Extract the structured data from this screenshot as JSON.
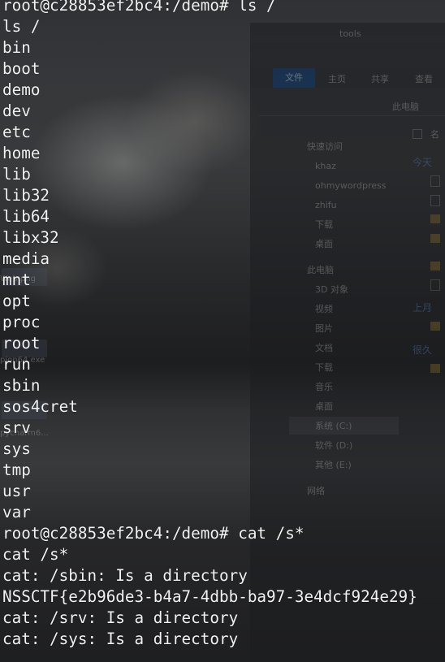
{
  "desktop": {
    "icon_labels": [
      "Web.png",
      "pion64.exe",
      "pycharm6..."
    ]
  },
  "explorer": {
    "title": "tools",
    "tabs": [
      "文件",
      "主页",
      "共享",
      "查看"
    ],
    "address": "此电脑",
    "column_header": "名",
    "nav_items": [
      {
        "label": "快速访问",
        "icon": "star-icon"
      },
      {
        "label": "khaz",
        "icon": "folder-icon"
      },
      {
        "label": "ohmywordpress",
        "icon": "folder-icon"
      },
      {
        "label": "zhifu",
        "icon": "folder-icon"
      },
      {
        "label": "下载",
        "icon": "download-icon"
      },
      {
        "label": "桌面",
        "icon": "desktop-icon"
      },
      {
        "label": "此电脑",
        "icon": "computer-icon"
      },
      {
        "label": "3D 对象",
        "icon": "cube-icon"
      },
      {
        "label": "视频",
        "icon": "video-icon"
      },
      {
        "label": "图片",
        "icon": "image-icon"
      },
      {
        "label": "文档",
        "icon": "document-icon"
      },
      {
        "label": "下载",
        "icon": "download-icon"
      },
      {
        "label": "音乐",
        "icon": "music-icon"
      },
      {
        "label": "桌面",
        "icon": "desktop-icon"
      },
      {
        "label": "系统 (C:)",
        "icon": "drive-icon"
      },
      {
        "label": "软件 (D:)",
        "icon": "drive-icon"
      },
      {
        "label": "其他 (E:)",
        "icon": "drive-icon"
      },
      {
        "label": "网络",
        "icon": "network-icon"
      }
    ],
    "groups": [
      "今天",
      "上月",
      "很久"
    ]
  },
  "terminal": {
    "lines": [
      "root@c28853ef2bc4:/demo# ls /",
      "ls /",
      "bin",
      "boot",
      "demo",
      "dev",
      "etc",
      "home",
      "lib",
      "lib32",
      "lib64",
      "libx32",
      "media",
      "mnt",
      "opt",
      "proc",
      "root",
      "run",
      "sbin",
      "sos4cret",
      "srv",
      "sys",
      "tmp",
      "usr",
      "var",
      "root@c28853ef2bc4:/demo# cat /s*",
      "cat /s*",
      "cat: /sbin: Is a directory",
      "NSSCTF{e2b96de3-b4a7-4dbb-ba97-3e4dcf924e29}",
      "cat: /srv: Is a directory",
      "cat: /sys: Is a directory"
    ]
  }
}
